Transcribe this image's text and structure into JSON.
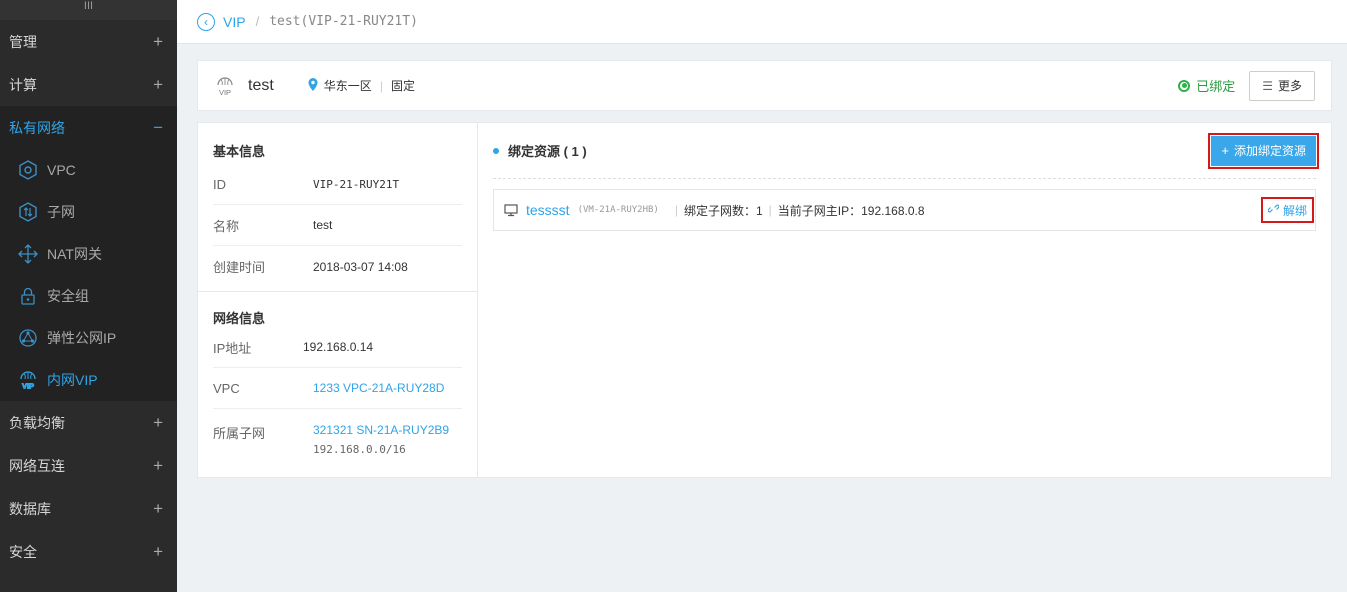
{
  "sidebar": {
    "grip": "III",
    "sections_top": [
      {
        "label": "管理",
        "toggle": "+"
      },
      {
        "label": "计算",
        "toggle": "+"
      }
    ],
    "active_section": {
      "label": "私有网络",
      "toggle": "−"
    },
    "items": [
      {
        "label": "VPC",
        "icon": "vpc-icon"
      },
      {
        "label": "子网",
        "icon": "subnet-icon"
      },
      {
        "label": "NAT网关",
        "icon": "nat-gateway-icon"
      },
      {
        "label": "安全组",
        "icon": "lock-icon"
      },
      {
        "label": "弹性公网IP",
        "icon": "eip-icon"
      },
      {
        "label": "内网VIP",
        "icon": "vip-icon"
      }
    ],
    "sections_bottom": [
      {
        "label": "负载均衡",
        "toggle": "+"
      },
      {
        "label": "网络互连",
        "toggle": "+"
      },
      {
        "label": "数据库",
        "toggle": "+"
      },
      {
        "label": "安全",
        "toggle": "+"
      }
    ]
  },
  "breadcrumb": {
    "parent": "VIP",
    "separator": "/",
    "current": "test(VIP-21-RUY21T)"
  },
  "titlebar": {
    "logo_text": "VIP",
    "name": "test",
    "region": "华东一区",
    "type": "固定",
    "status": "已绑定",
    "more_label": "更多"
  },
  "basic_info": {
    "title": "基本信息",
    "rows": [
      {
        "key": "ID",
        "value": "VIP-21-RUY21T"
      },
      {
        "key": "名称",
        "value": "test"
      },
      {
        "key": "创建时间",
        "value": "2018-03-07 14:08"
      }
    ]
  },
  "network_info": {
    "title": "网络信息",
    "ip_key": "IP地址",
    "ip_value": "192.168.0.14",
    "vpc_key": "VPC",
    "vpc_value": "1233 VPC-21A-RUY28D",
    "subnet_key": "所属子网",
    "subnet_value": "321321 SN-21A-RUY2B9",
    "subnet_cidr": "192.168.0.0/16"
  },
  "bound_resources": {
    "title": "绑定资源 ( 1 )",
    "add_label": "添加绑定资源",
    "items": [
      {
        "name": "tesssst",
        "id": "(VM-21A-RUY2HB)",
        "subnet_count": "绑定子网数：1",
        "main_ip": "当前子网主IP：192.168.0.8",
        "unbind_label": "解绑"
      }
    ]
  },
  "colors": {
    "accent": "#2fa4e7",
    "sidebar_bg": "#2b2b2b",
    "status_green": "#2bb34a",
    "highlight_red": "#d31919"
  }
}
